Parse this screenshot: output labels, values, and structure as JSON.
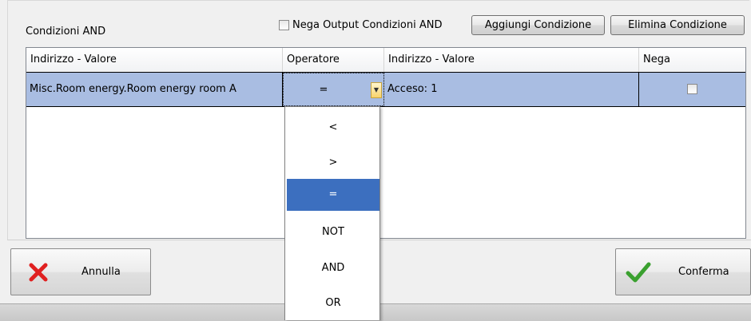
{
  "and_conditions": {
    "title": "Condizioni AND",
    "negate_output_label": "Nega Output Condizioni AND",
    "negate_output_checked": false,
    "add_button": "Aggiungi Condizione",
    "delete_button": "Elimina Condizione"
  },
  "grid": {
    "columns": [
      "Indirizzo - Valore",
      "Operatore",
      "Indirizzo - Valore",
      "Nega"
    ],
    "rows": [
      {
        "address_left": "Misc.Room energy.Room energy room A",
        "operator": "=",
        "address_right": "Acceso: 1",
        "negate": false
      }
    ]
  },
  "operator_dropdown": {
    "options": [
      "<",
      ">",
      "=",
      "NOT",
      "AND",
      "OR"
    ],
    "selected": "="
  },
  "footer": {
    "cancel_label": "Annulla",
    "confirm_label": "Conferma"
  },
  "colors": {
    "selected_row": "#a9bde2",
    "dropdown_selected": "#3c6fbf",
    "cancel_icon": "#e02020",
    "confirm_icon": "#3aa02f"
  },
  "icons": {
    "cancel": "red-x-icon",
    "confirm": "green-check-icon",
    "combo": "chevron-down-icon"
  }
}
